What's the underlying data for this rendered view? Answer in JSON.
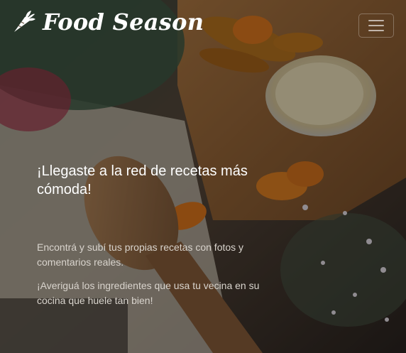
{
  "navbar": {
    "brand": {
      "icon": "carrot-icon",
      "name": "Food Season"
    },
    "menu_toggle": {
      "icon": "hamburger-icon"
    }
  },
  "hero": {
    "headline": "¡Llegaste a la red de recetas más cómoda!",
    "paragraph_1": "Encontrá y subí tus propias recetas con fotos y comentarios reales.",
    "paragraph_2": "¡Averiguá los ingredientes que usa tu vecina en su cocina que huele tan bien!",
    "background_image": "food-background-photo"
  },
  "colors": {
    "text_primary": "#ffffff",
    "text_secondary": "#d9d4cd",
    "overlay": "rgba(0,0,0,0.38)"
  }
}
